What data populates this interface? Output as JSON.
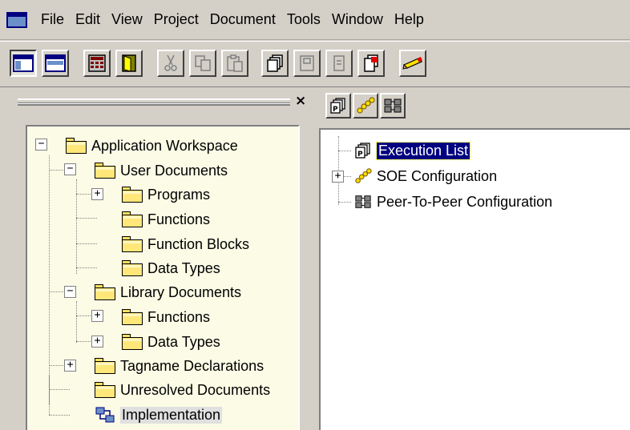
{
  "menubar": {
    "items": [
      "File",
      "Edit",
      "View",
      "Project",
      "Document",
      "Tools",
      "Window",
      "Help"
    ]
  },
  "toolbar": {
    "buttons": [
      {
        "icon": "window-layout-icon",
        "state": "pressed"
      },
      {
        "icon": "split-pane-icon",
        "state": "raised"
      },
      {
        "icon": "calculator-icon",
        "state": "raised"
      },
      {
        "icon": "exit-door-icon",
        "state": "raised"
      },
      {
        "icon": "cut-icon",
        "state": "disabled"
      },
      {
        "icon": "copy-icon",
        "state": "disabled"
      },
      {
        "icon": "paste-icon",
        "state": "disabled"
      },
      {
        "icon": "stacked-documents-icon",
        "state": "raised"
      },
      {
        "icon": "save-document-icon",
        "state": "disabled"
      },
      {
        "icon": "blank-document-icon",
        "state": "disabled"
      },
      {
        "icon": "document-tag-icon",
        "state": "raised"
      },
      {
        "icon": "pencil-icon",
        "state": "raised"
      }
    ]
  },
  "left_tree": {
    "root": "Application Workspace",
    "user_documents": "User Documents",
    "programs": "Programs",
    "functions": "Functions",
    "function_blocks": "Function Blocks",
    "data_types": "Data Types",
    "library_documents": "Library Documents",
    "lib_functions": "Functions",
    "lib_data_types": "Data Types",
    "tagname_declarations": "Tagname Declarations",
    "unresolved_documents": "Unresolved Documents",
    "implementation": "Implementation"
  },
  "right_tree": {
    "execution_list": "Execution List",
    "soe_configuration": "SOE Configuration",
    "peer_to_peer": "Peer-To-Peer Configuration"
  },
  "colors": {
    "chrome": "#d4d0c8",
    "tree_background": "#fbfbe6",
    "selection": "#000080",
    "folder": "#ffe77a"
  },
  "panel": {
    "close_glyph": "×"
  }
}
